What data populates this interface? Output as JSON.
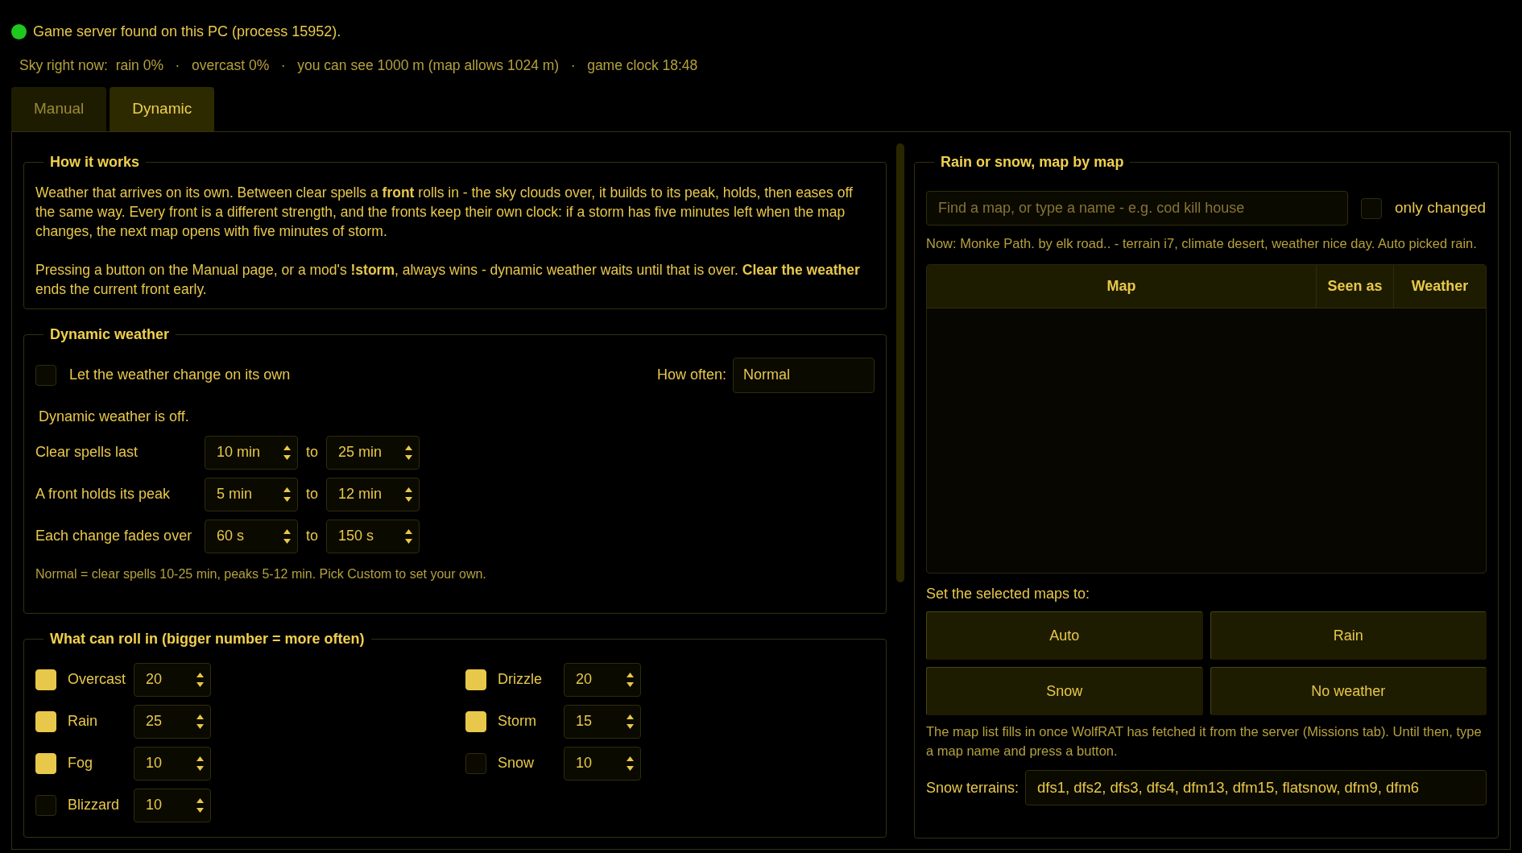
{
  "status": {
    "connected": true,
    "text": "Game server found on this PC (process 15952)."
  },
  "sky_line": "Sky right now:  rain 0%   ·   overcast 0%   ·   you can see 1000 m (map allows 1024 m)   ·   game clock 18:48",
  "tabs": [
    {
      "label": "Manual",
      "selected": false
    },
    {
      "label": "Dynamic",
      "selected": true
    }
  ],
  "how_it_works": {
    "title": "How it works",
    "paragraphs": [
      "Weather that arrives on its own. Between clear spells a **front** rolls in - the sky clouds over, it builds to its peak, holds, then eases off the same way. Every front is a different strength, and the fronts keep their own clock: if a storm has five minutes left when the map changes, the next map opens with five minutes of storm.",
      "Pressing a button on the Manual page, or a mod's **!storm**, always wins - dynamic weather waits until that is over. **Clear the weather** ends the current front early."
    ]
  },
  "dynamic_weather": {
    "title": "Dynamic weather",
    "enable": {
      "label": "Let the weather change on its own",
      "checked": false
    },
    "how_often": {
      "label": "How often:",
      "value": "Normal"
    },
    "state_text": "Dynamic weather is off.",
    "ranges": [
      {
        "label": "Clear spells last",
        "from": "10 min",
        "joiner": "to",
        "to": "25 min"
      },
      {
        "label": "A front holds its peak",
        "from": "5 min",
        "joiner": "to",
        "to": "12 min"
      },
      {
        "label": "Each change fades over",
        "from": "60 s",
        "joiner": "to",
        "to": "150 s"
      }
    ],
    "note": "Normal = clear spells 10-25 min, peaks 5-12 min. Pick Custom to set your own."
  },
  "what_can_roll_in": {
    "title": "What can roll in  (bigger number = more often)",
    "items": [
      {
        "label": "Overcast",
        "checked": true,
        "value": "20"
      },
      {
        "label": "Drizzle",
        "checked": true,
        "value": "20"
      },
      {
        "label": "Rain",
        "checked": true,
        "value": "25"
      },
      {
        "label": "Storm",
        "checked": true,
        "value": "15"
      },
      {
        "label": "Fog",
        "checked": true,
        "value": "10"
      },
      {
        "label": "Snow",
        "checked": false,
        "value": "10"
      },
      {
        "label": "Blizzard",
        "checked": false,
        "value": "10"
      }
    ]
  },
  "map_panel": {
    "title": "Rain or snow, map by map",
    "search": {
      "placeholder": "Find a map, or type a name - e.g. cod kill house"
    },
    "only_changed": {
      "label": "only changed",
      "checked": false
    },
    "now_text": "Now: Monke Path. by elk road..  -  terrain i7, climate desert, weather nice day.  Auto picked rain.",
    "table": {
      "columns": [
        "Map",
        "Seen as",
        "Weather"
      ]
    },
    "set_label": "Set the selected maps to:",
    "buttons": [
      "Auto",
      "Rain",
      "Snow",
      "No weather"
    ],
    "note": "The map list fills in once WolfRAT has fetched it from the server (Missions tab). Until then, type a map name and press a button.",
    "snow_terrains": {
      "label": "Snow terrains:",
      "value": "dfs1, dfs2, dfs3, dfs4, dfm13, dfm15, flatsnow, dfm9, dfm6"
    }
  }
}
